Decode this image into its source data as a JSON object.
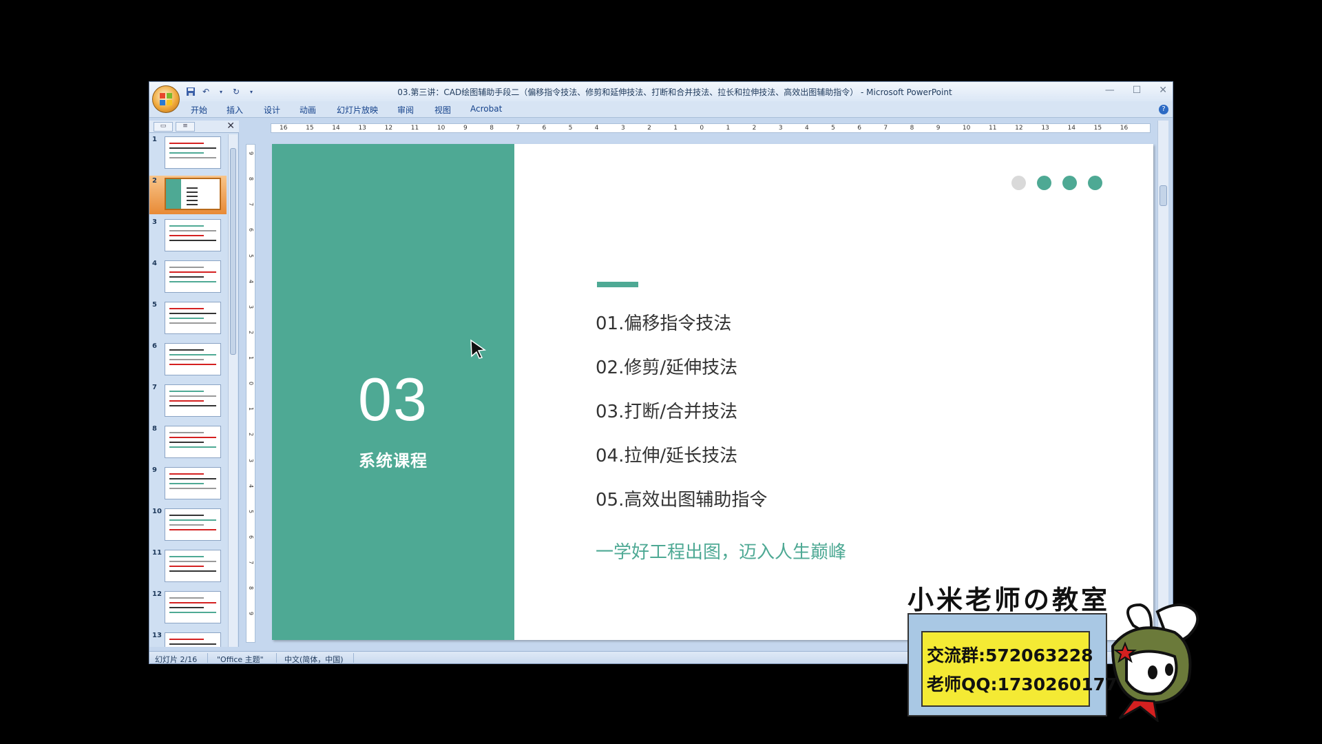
{
  "window": {
    "title": "03.第三讲：CAD绘图辅助手段二（偏移指令技法、修剪和延伸技法、打断和合并技法、拉长和拉伸技法、高效出图辅助指令） - Microsoft PowerPoint",
    "controls": {
      "minimize": "—",
      "maximize": "☐",
      "close": "✕"
    }
  },
  "ribbon": {
    "tabs": [
      "开始",
      "插入",
      "设计",
      "动画",
      "幻灯片放映",
      "审阅",
      "视图",
      "Acrobat"
    ],
    "help": "?"
  },
  "thumbnails": {
    "numbers": [
      "1",
      "2",
      "3",
      "4",
      "5",
      "6",
      "7",
      "8",
      "9",
      "10",
      "11",
      "12",
      "13"
    ],
    "selected_index": 2
  },
  "ruler": {
    "horizontal": [
      "16",
      "15",
      "14",
      "13",
      "12",
      "11",
      "10",
      "9",
      "8",
      "7",
      "6",
      "5",
      "4",
      "3",
      "2",
      "1",
      "0",
      "1",
      "2",
      "3",
      "4",
      "5",
      "6",
      "7",
      "8",
      "9",
      "10",
      "11",
      "12",
      "13",
      "14",
      "15",
      "16"
    ],
    "vertical": [
      "9",
      "8",
      "7",
      "6",
      "5",
      "4",
      "3",
      "2",
      "1",
      "0",
      "1",
      "2",
      "3",
      "4",
      "5",
      "6",
      "7",
      "8",
      "9"
    ]
  },
  "slide": {
    "section_number": "03",
    "section_label": "系统课程",
    "agenda": [
      "01.偏移指令技法",
      "02.修剪/延伸技法",
      "03.打断/合并技法",
      "04.拉伸/延长技法",
      "05.高效出图辅助指令"
    ],
    "tagline": "一学好工程出图，迈入人生巅峰",
    "colors": {
      "accent": "#4ea994",
      "dot_inactive": "#d9d9d9"
    },
    "dots": [
      "inactive",
      "active",
      "active",
      "active"
    ]
  },
  "status_bar": {
    "slide_info": "幻灯片 2/16",
    "theme": "\"Office 主题\"",
    "language": "中文(简体，中国)"
  },
  "watermark": {
    "title": "小米老师の教室",
    "group_line": "交流群:572063228",
    "qq_line": "老师QQ:1730260177"
  }
}
